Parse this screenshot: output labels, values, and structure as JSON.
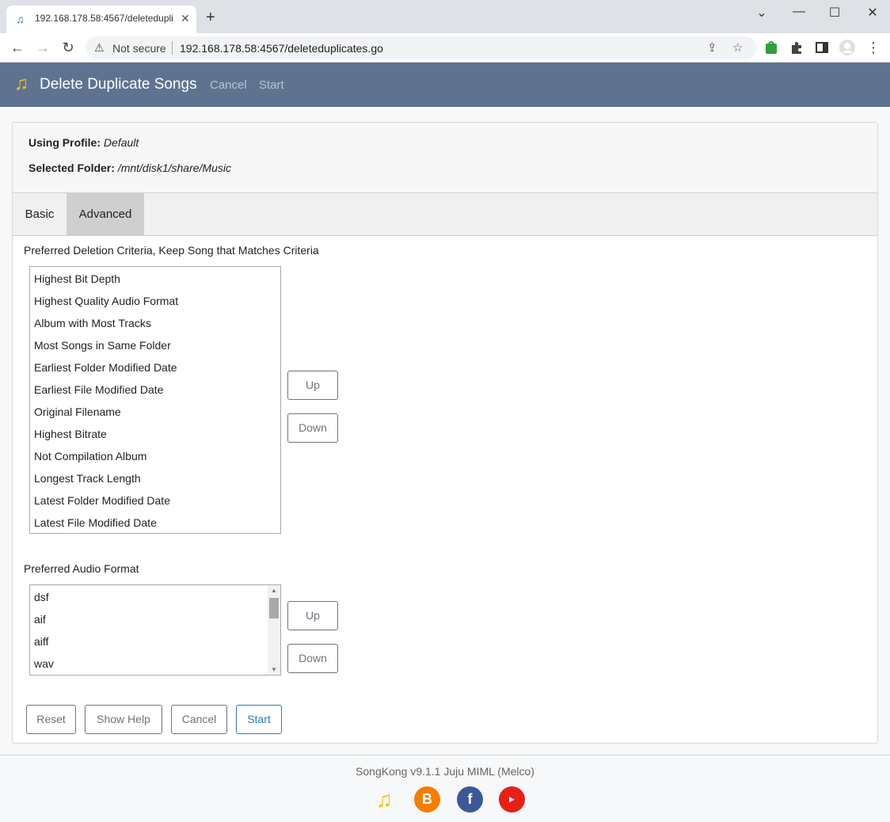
{
  "browser": {
    "tab_title": "192.168.178.58:4567/deletedupli",
    "not_secure": "Not secure",
    "url": "192.168.178.58:4567/deleteduplicates.go"
  },
  "header": {
    "title": "Delete Duplicate Songs",
    "nav_cancel": "Cancel",
    "nav_start": "Start"
  },
  "profile": {
    "profile_label": "Using Profile:",
    "profile_value": "Default",
    "folder_label": "Selected Folder:",
    "folder_value": "/mnt/disk1/share/Music"
  },
  "tabs": [
    {
      "label": "Basic"
    },
    {
      "label": "Advanced"
    }
  ],
  "deletion": {
    "label": "Preferred Deletion Criteria, Keep Song that Matches Criteria",
    "items": [
      "Highest Bit Depth",
      "Highest Quality Audio Format",
      "Album with Most Tracks",
      "Most Songs in Same Folder",
      "Earliest Folder Modified Date",
      "Earliest File Modified Date",
      "Original Filename",
      "Highest Bitrate",
      "Not Compilation Album",
      "Longest Track Length",
      "Latest Folder Modified Date",
      "Latest File Modified Date"
    ],
    "up": "Up",
    "down": "Down"
  },
  "format": {
    "label": "Preferred Audio Format",
    "items": [
      "dsf",
      "aif",
      "aiff",
      "wav"
    ],
    "up": "Up",
    "down": "Down"
  },
  "actions": {
    "reset": "Reset",
    "show_help": "Show Help",
    "cancel": "Cancel",
    "start": "Start"
  },
  "footer": {
    "text": "SongKong v9.1.1 Juju MIML (Melco)"
  },
  "colors": {
    "appbar": "#5f7390",
    "primary": "#2a7bb8"
  }
}
